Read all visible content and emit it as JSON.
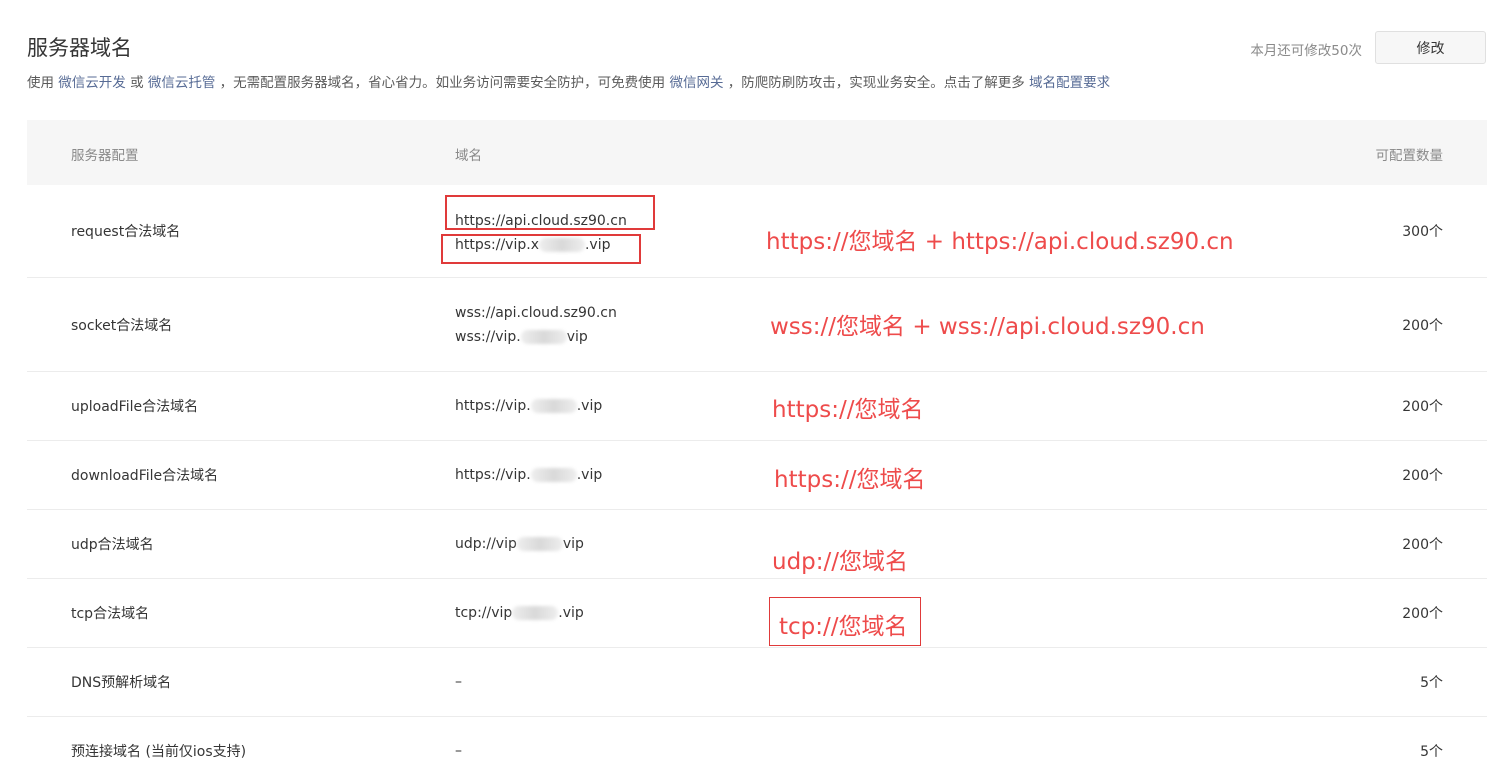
{
  "header": {
    "title": "服务器域名",
    "remaining": "本月还可修改50次",
    "modify_label": "修改"
  },
  "description": {
    "t1": "使用 ",
    "link1": "微信云开发",
    "t2": " 或 ",
    "link2": "微信云托管",
    "t3": " ，无需配置服务器域名，省心省力。如业务访问需要安全防护，可免费使用 ",
    "link3": "微信网关",
    "t4": " ，防爬防刷防攻击，实现业务安全。点击了解更多 ",
    "link4": "域名配置要求"
  },
  "table": {
    "headers": {
      "config": "服务器配置",
      "domain": "域名",
      "count": "可配置数量"
    },
    "rows": [
      {
        "config": "request合法域名",
        "domain1": "https://api.cloud.sz90.cn",
        "domain2_prefix": "https://vip.x",
        "domain2_suffix": ".vip",
        "count": "300个"
      },
      {
        "config": "socket合法域名",
        "domain1": "wss://api.cloud.sz90.cn",
        "domain2_prefix": "wss://vip.",
        "domain2_suffix": "vip",
        "count": "200个"
      },
      {
        "config": "uploadFile合法域名",
        "domain_prefix": "https://vip.",
        "domain_suffix": ".vip",
        "count": "200个"
      },
      {
        "config": "downloadFile合法域名",
        "domain_prefix": "https://vip.",
        "domain_suffix": ".vip",
        "count": "200个"
      },
      {
        "config": "udp合法域名",
        "domain_prefix": "udp://vip",
        "domain_suffix": "vip",
        "count": "200个"
      },
      {
        "config": "tcp合法域名",
        "domain_prefix": "tcp://vip",
        "domain_suffix": ".vip",
        "count": "200个"
      },
      {
        "config": "DNS预解析域名",
        "domain": "–",
        "count": "5个"
      },
      {
        "config": "预连接域名 (当前仅ios支持)",
        "domain": "–",
        "count": "5个"
      }
    ]
  },
  "annotations": {
    "request": "https://您域名 + https://api.cloud.sz90.cn",
    "socket": "wss://您域名  + wss://api.cloud.sz90.cn",
    "upload": "https://您域名",
    "download": "https://您域名",
    "udp": "udp://您域名",
    "tcp": "tcp://您域名"
  },
  "colors": {
    "link": "#576b95",
    "annotation": "#ee4b4b",
    "header_bg": "#f6f6f6"
  }
}
